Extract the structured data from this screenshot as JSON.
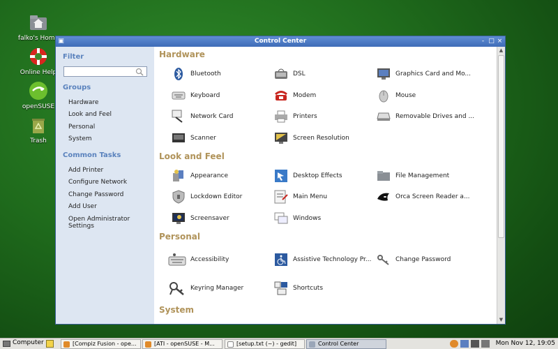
{
  "desktop": {
    "icons": [
      {
        "label": "falko's Home",
        "icon": "home-folder-icon"
      },
      {
        "label": "Online Help",
        "icon": "lifebuoy-icon"
      },
      {
        "label": "openSUSE",
        "icon": "opensuse-logo-icon"
      },
      {
        "label": "Trash",
        "icon": "trash-icon"
      }
    ]
  },
  "window": {
    "title": "Control Center",
    "buttons": [
      "-",
      "□",
      "×"
    ]
  },
  "sidebar": {
    "filter_label": "Filter",
    "filter_value": "",
    "groups_label": "Groups",
    "groups": [
      "Hardware",
      "Look and Feel",
      "Personal",
      "System"
    ],
    "tasks_label": "Common Tasks",
    "tasks": [
      "Add Printer",
      "Configure Network",
      "Change Password",
      "Add User",
      "Open Administrator Settings"
    ]
  },
  "sections": [
    {
      "title": "Hardware",
      "items": [
        {
          "label": "Bluetooth",
          "icon": "bluetooth-icon"
        },
        {
          "label": "DSL",
          "icon": "dsl-icon"
        },
        {
          "label": "Graphics Card and Mo...",
          "icon": "monitor-icon"
        },
        {
          "label": "Keyboard",
          "icon": "keyboard-icon"
        },
        {
          "label": "Modem",
          "icon": "modem-phone-icon"
        },
        {
          "label": "Mouse",
          "icon": "mouse-icon"
        },
        {
          "label": "Network Card",
          "icon": "network-card-icon"
        },
        {
          "label": "Printers",
          "icon": "printer-icon"
        },
        {
          "label": "Removable Drives and ...",
          "icon": "drive-icon"
        },
        {
          "label": "Scanner",
          "icon": "scanner-icon"
        },
        {
          "label": "Screen Resolution",
          "icon": "screen-resolution-icon"
        }
      ]
    },
    {
      "title": "Look and Feel",
      "items": [
        {
          "label": "Appearance",
          "icon": "appearance-icon"
        },
        {
          "label": "Desktop Effects",
          "icon": "desktop-effects-icon"
        },
        {
          "label": "File Management",
          "icon": "folder-icon"
        },
        {
          "label": "Lockdown Editor",
          "icon": "shield-icon"
        },
        {
          "label": "Main Menu",
          "icon": "main-menu-icon"
        },
        {
          "label": "Orca Screen Reader a...",
          "icon": "orca-icon"
        },
        {
          "label": "Screensaver",
          "icon": "screensaver-icon"
        },
        {
          "label": "Windows",
          "icon": "windows-icon"
        }
      ]
    },
    {
      "title": "Personal",
      "items": [
        {
          "label": "Accessibility",
          "icon": "accessibility-keyboard-icon"
        },
        {
          "label": "Assistive Technology Pr...",
          "icon": "wheelchair-icon"
        },
        {
          "label": "Change Password",
          "icon": "keys-icon"
        },
        {
          "label": "Keyring Manager",
          "icon": "keyring-icon"
        },
        {
          "label": "Shortcuts",
          "icon": "shortcuts-icon"
        }
      ]
    },
    {
      "title": "System",
      "items": []
    }
  ],
  "taskbar": {
    "computer_label": "Computer",
    "tasks": [
      {
        "label": "[Compiz Fusion - ope..."
      },
      {
        "label": "[ATI - openSUSE - M..."
      },
      {
        "label": "[setup.txt (~) - gedit]"
      },
      {
        "label": "Control Center"
      }
    ],
    "clock": "Mon Nov 12, 19:05"
  },
  "colors": {
    "section_heading": "#b0935a",
    "sidebar_heading": "#5a82bd",
    "titlebar": "#4a78c4"
  }
}
